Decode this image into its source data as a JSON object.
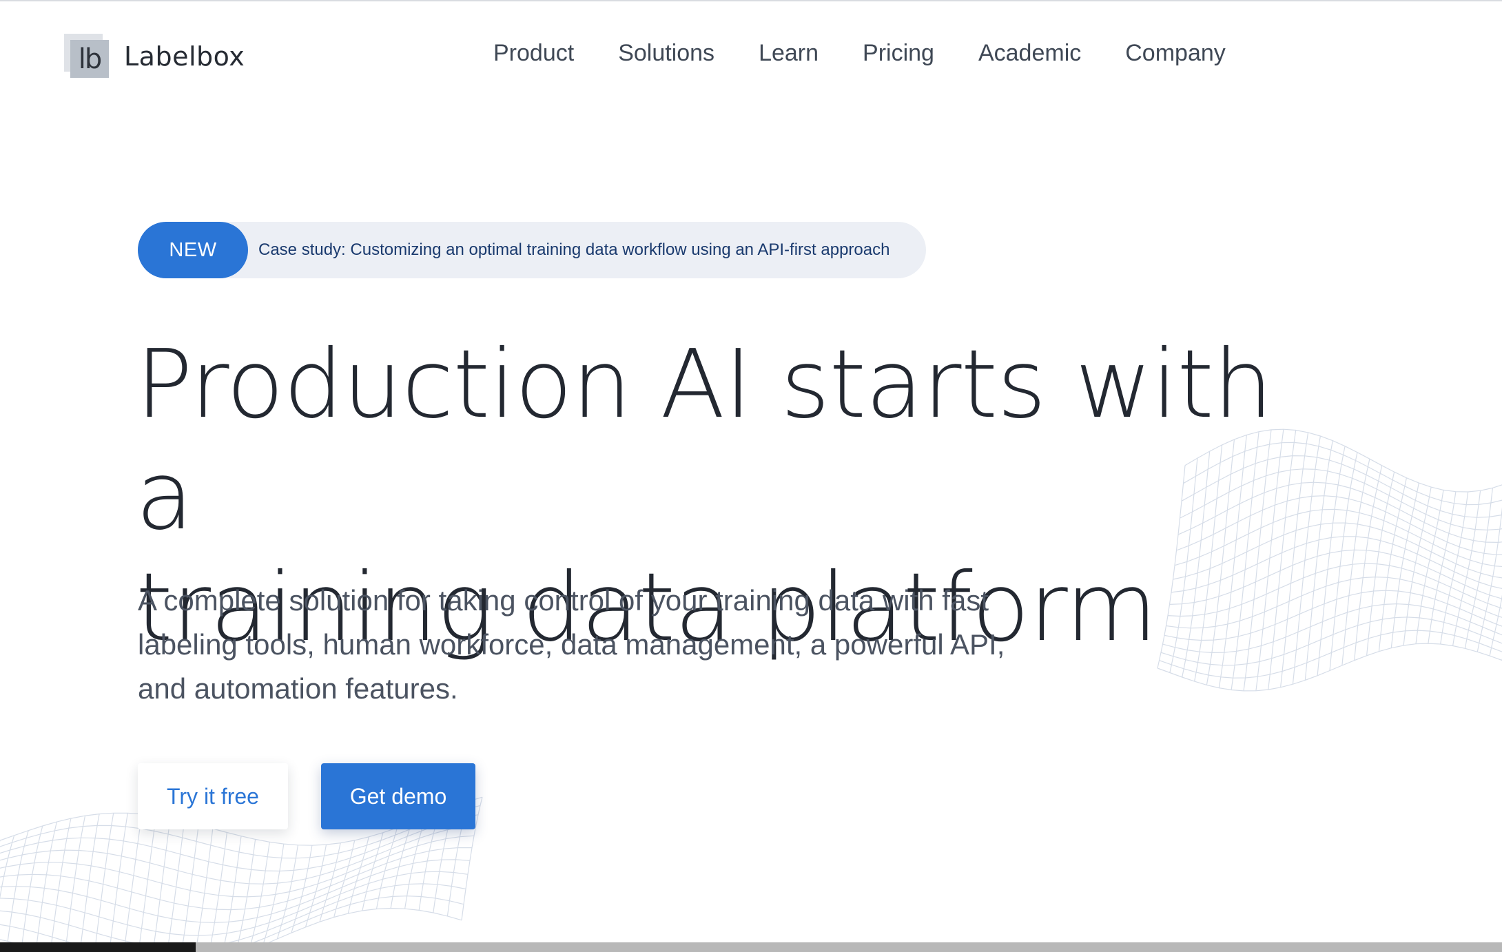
{
  "brand": {
    "logo_glyph": "lb",
    "name": "Labelbox"
  },
  "nav": {
    "items": [
      {
        "label": "Product"
      },
      {
        "label": "Solutions"
      },
      {
        "label": "Learn"
      },
      {
        "label": "Pricing"
      },
      {
        "label": "Academic"
      },
      {
        "label": "Company"
      }
    ]
  },
  "announcement": {
    "badge": "NEW",
    "text": "Case study: Customizing an optimal training data workflow using an API-first approach"
  },
  "hero": {
    "title_line1": "Production AI starts with a",
    "title_line2": "training data platform",
    "subtitle_line1": "A complete solution for taking control of your training data with fast",
    "subtitle_line2": "labeling tools, human workforce, data management, a powerful API,",
    "subtitle_line3": "and automation features."
  },
  "cta": {
    "try_label": "Try it free",
    "demo_label": "Get demo"
  },
  "colors": {
    "accent": "#2a75d6",
    "text": "#262b33",
    "pill_bg": "#eceff5",
    "mesh": "#d6dde8"
  },
  "icons": {
    "logo": "labelbox-logo-icon",
    "decoration": "wave-mesh-graphic"
  }
}
